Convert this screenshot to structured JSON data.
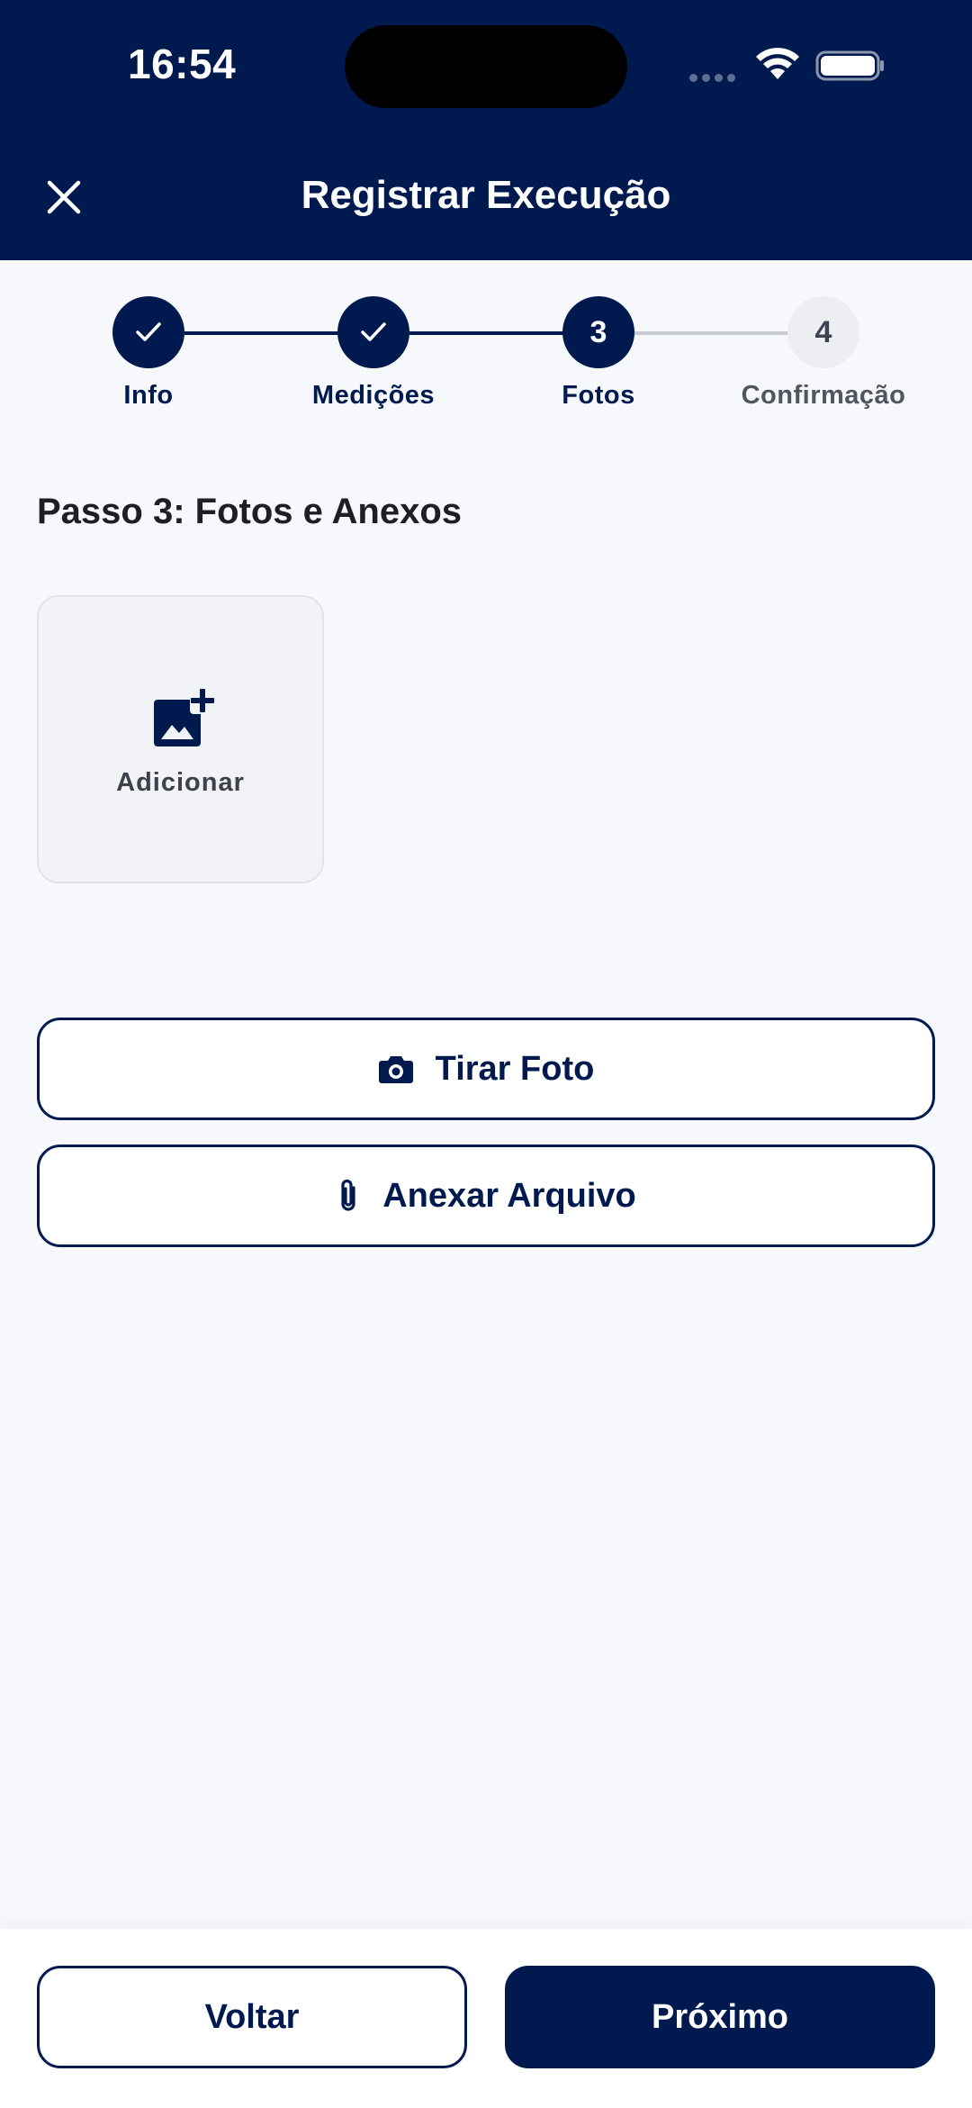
{
  "status_bar": {
    "time": "16:54"
  },
  "header": {
    "title": "Registrar Execução",
    "close_icon": "close-icon"
  },
  "stepper": {
    "steps": [
      {
        "number": "1",
        "label": "Info",
        "state": "done"
      },
      {
        "number": "2",
        "label": "Medições",
        "state": "done"
      },
      {
        "number": "3",
        "label": "Fotos",
        "state": "active"
      },
      {
        "number": "4",
        "label": "Confirmação",
        "state": "pending"
      }
    ]
  },
  "section": {
    "title": "Passo 3: Fotos e Anexos"
  },
  "attachments": {
    "add_label": "Adicionar",
    "add_icon": "add-photo-icon"
  },
  "actions": {
    "take_photo_label": "Tirar Foto",
    "take_photo_icon": "camera-icon",
    "attach_file_label": "Anexar Arquivo",
    "attach_file_icon": "paperclip-icon"
  },
  "footer": {
    "back_label": "Voltar",
    "next_label": "Próximo"
  },
  "colors": {
    "primary": "#001A4F",
    "background": "#F6F8FC",
    "pending_step": "#ECEEF2",
    "pending_line": "#C8CBD2"
  }
}
